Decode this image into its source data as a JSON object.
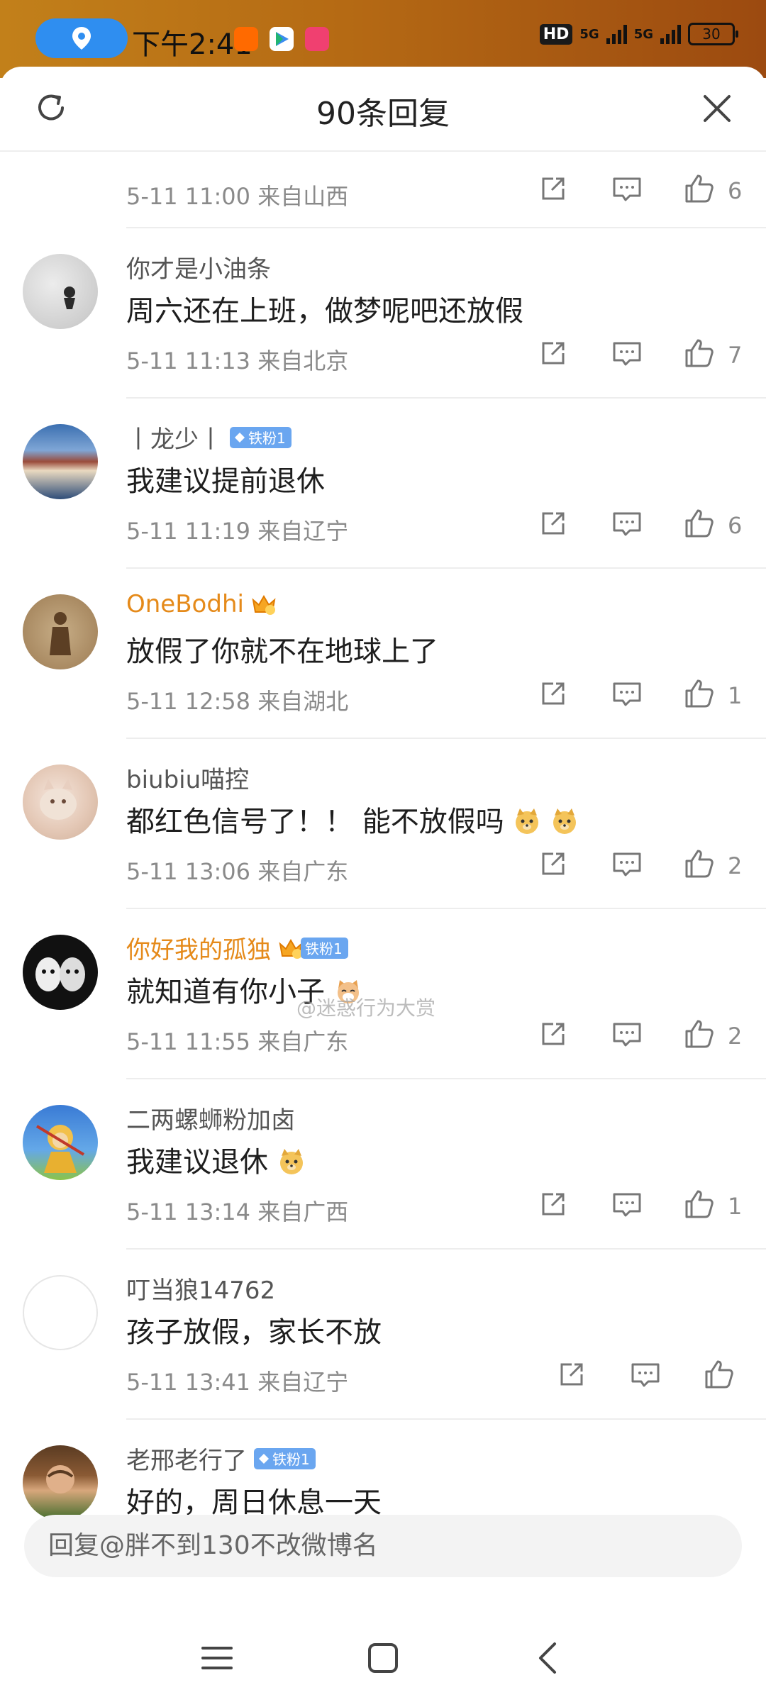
{
  "status_bar": {
    "time": "下午2:41",
    "hd_label": "HD",
    "signal_1": "5G",
    "signal_2": "5G",
    "battery": "30"
  },
  "sheet": {
    "title": "90条回复"
  },
  "comments": [
    {
      "meta": "5-11 11:00 来自山西",
      "likes": "6"
    },
    {
      "user": "你才是小油条",
      "text": "周六还在上班，做梦呢吧还放假",
      "meta": "5-11 11:13 来自北京",
      "likes": "7"
    },
    {
      "user": "丨龙少丨",
      "badge": "铁粉1",
      "text": "我建议提前退休",
      "meta": "5-11 11:19 来自辽宁",
      "likes": "6"
    },
    {
      "user": "OneBodhi",
      "text": "放假了你就不在地球上了",
      "meta": "5-11 12:58 来自湖北",
      "likes": "1"
    },
    {
      "user": "biubiu喵控",
      "text": "都红色信号了！！ 能不放假吗",
      "meta": "5-11 13:06 来自广东",
      "likes": "2"
    },
    {
      "user": "你好我的孤独",
      "badge": "铁粉1",
      "text": "就知道有你小子",
      "meta": "5-11 11:55 来自广东",
      "likes": "2"
    },
    {
      "user": "二两螺蛳粉加卤",
      "text": "我建议退休",
      "meta": "5-11 13:14 来自广西",
      "likes": "1"
    },
    {
      "user": "叮当狼14762",
      "text": "孩子放假，家长不放",
      "meta": "5-11 13:41 来自辽宁",
      "likes": ""
    },
    {
      "user": "老邢老行了",
      "badge": "铁粉1",
      "text": "好的，周日休息一天",
      "meta": "",
      "likes": ""
    }
  ],
  "watermark": "@迷惑行为大赏",
  "reply_input": {
    "placeholder": "回复@胖不到130不改微博名"
  },
  "icons": [
    "location-icon",
    "refresh-icon",
    "close-icon",
    "share-icon",
    "comment-icon",
    "like-icon",
    "menu-icon",
    "home-icon",
    "back-icon"
  ],
  "colors": {
    "accent_blue": "#2f8ef0",
    "vip_name": "#e58a1a",
    "badge": "#6aa6f0",
    "meta_text": "#8a8a8a"
  }
}
